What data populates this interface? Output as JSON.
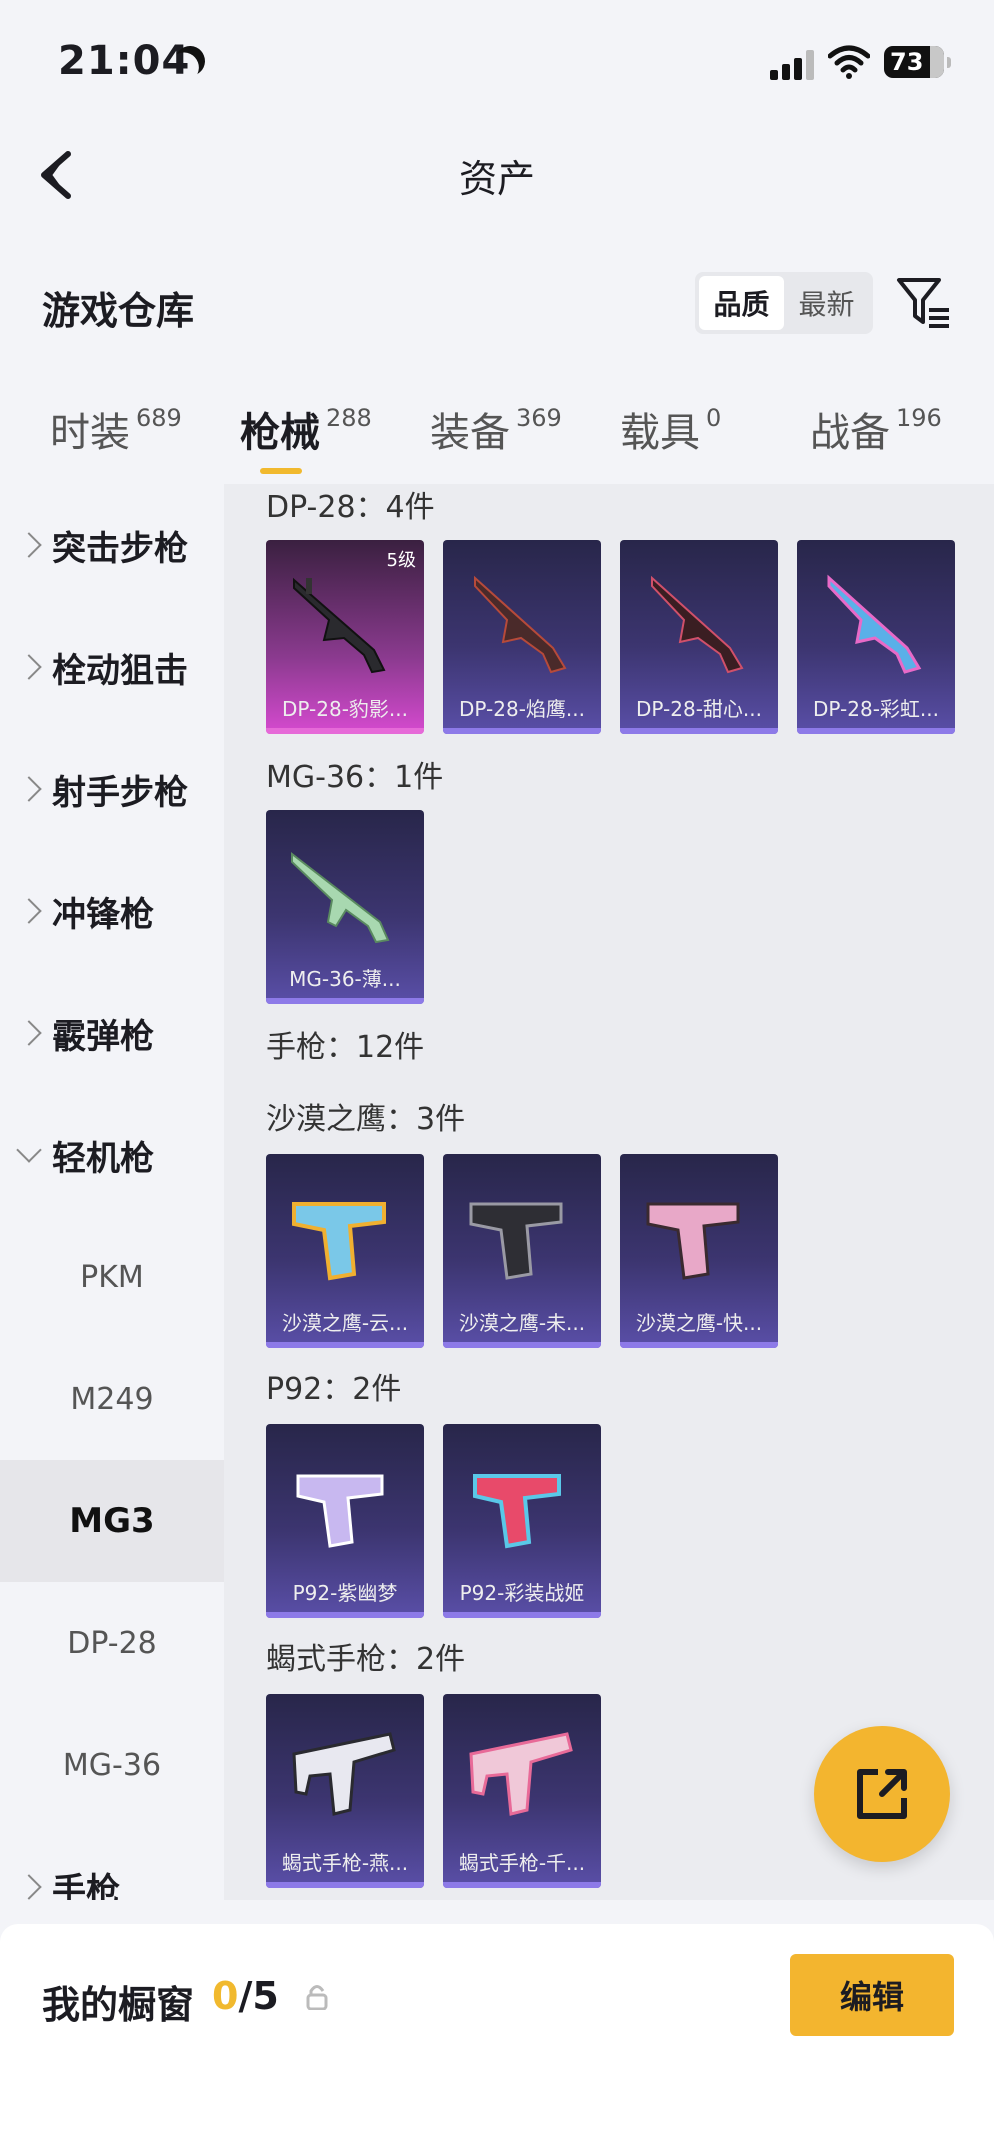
{
  "status": {
    "time": "21:04",
    "battery": "73"
  },
  "header": {
    "title": "资产",
    "section_title": "游戏仓库",
    "sort_options": [
      "品质",
      "最新"
    ]
  },
  "tabs": [
    {
      "label": "时装",
      "count": "689"
    },
    {
      "label": "枪械",
      "count": "288"
    },
    {
      "label": "装备",
      "count": "369"
    },
    {
      "label": "载具",
      "count": "0"
    },
    {
      "label": "战备",
      "count": "196"
    }
  ],
  "sidebar": {
    "categories": [
      "突击步枪",
      "栓动狙击",
      "射手步枪",
      "冲锋枪",
      "霰弹枪",
      "轻机枪"
    ],
    "subitems": [
      "PKM",
      "M249",
      "MG3",
      "DP-28",
      "MG-36"
    ],
    "trailing": "手枪"
  },
  "groups": [
    {
      "label": "DP-28：4件"
    },
    {
      "label": "MG-36：1件"
    },
    {
      "label": "手枪：12件"
    },
    {
      "label": "沙漠之鹰：3件"
    },
    {
      "label": "P92：2件"
    },
    {
      "label": "蝎式手枪：2件"
    }
  ],
  "cards": [
    {
      "name": "DP-28-豹影...",
      "badge": "5级"
    },
    {
      "name": "DP-28-焰鹰..."
    },
    {
      "name": "DP-28-甜心..."
    },
    {
      "name": "DP-28-彩虹..."
    },
    {
      "name": "MG-36-薄..."
    },
    {
      "name": "沙漠之鹰-云..."
    },
    {
      "name": "沙漠之鹰-未..."
    },
    {
      "name": "沙漠之鹰-快..."
    },
    {
      "name": "P92-紫幽梦"
    },
    {
      "name": "P92-彩装战姬"
    },
    {
      "name": "蝎式手枪-燕..."
    },
    {
      "name": "蝎式手枪-千..."
    }
  ],
  "bottom": {
    "label": "我的橱窗",
    "current": "0",
    "total": "/5",
    "edit": "编辑"
  },
  "colors": {
    "accent": "#f3b52f",
    "card_bg": "#3c3570",
    "gold_card": "#d64ad0"
  },
  "icons": [
    "back-arrow-icon",
    "filter-icon",
    "share-icon",
    "lock-icon",
    "moon-icon",
    "signal-icon",
    "wifi-icon"
  ]
}
